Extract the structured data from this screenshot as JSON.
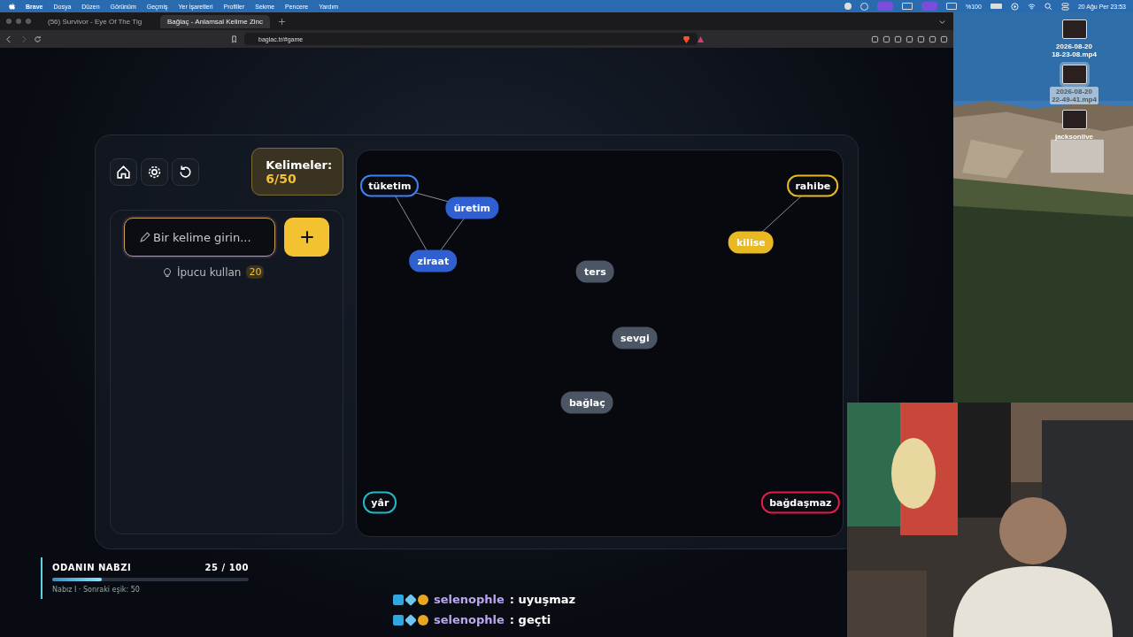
{
  "menu_bar": {
    "app": "Brave",
    "items": [
      "Dosya",
      "Düzen",
      "Görünüm",
      "Geçmiş",
      "Yer İşaretleri",
      "Profiller",
      "Sekme",
      "Pencere",
      "Yardım"
    ],
    "battery": "%100",
    "clock": "20 Ağu Per 23:53"
  },
  "browser": {
    "tabs": [
      {
        "title": "(56) Survivor - Eye Of The Tig",
        "selected": false
      },
      {
        "title": "Bağlaç - Anlamsal Kelime Zinc",
        "selected": true
      }
    ],
    "url": "baglac.tr/#game"
  },
  "game": {
    "counter_label": "Kelimeler:",
    "counter_value": "6/50",
    "input": {
      "placeholder": "Bir kelime girin..."
    },
    "hint": {
      "label": "İpucu kullan",
      "count": "20"
    },
    "nodes": [
      {
        "word": "tüketim",
        "kind": "target",
        "color": "#3b82f6"
      },
      {
        "word": "üretim",
        "kind": "word",
        "color": "#2f5fd0"
      },
      {
        "word": "ziraat",
        "kind": "word",
        "color": "#2f5fd0"
      },
      {
        "word": "ters",
        "kind": "word",
        "color": "#4b5563"
      },
      {
        "word": "sevgi",
        "kind": "word",
        "color": "#4b5563"
      },
      {
        "word": "bağlaç",
        "kind": "word",
        "color": "#4b5563"
      },
      {
        "word": "kilise",
        "kind": "word",
        "color": "#e8b923"
      },
      {
        "word": "rahibe",
        "kind": "target",
        "color": "#e8b923"
      },
      {
        "word": "yâr",
        "kind": "target",
        "color": "#22b8c8"
      },
      {
        "word": "bağdaşmaz",
        "kind": "target",
        "color": "#e11d48"
      }
    ]
  },
  "pulse": {
    "title": "ODANIN NABZI",
    "score": "25 / 100",
    "level": 0.25,
    "note": "Nabız I · Sonraki eşik: 50"
  },
  "chat": [
    {
      "user": "selenophle",
      "message": ": uyuşmaz"
    },
    {
      "user": "selenophle",
      "message": ": geçti"
    }
  ],
  "desktop": [
    {
      "name": "2026-08-20\n18-23-08.mp4",
      "selected": false
    },
    {
      "name": "2026-08-20\n22-49-41.mp4",
      "selected": true
    },
    {
      "name": "jacksonlive",
      "selected": false
    }
  ]
}
